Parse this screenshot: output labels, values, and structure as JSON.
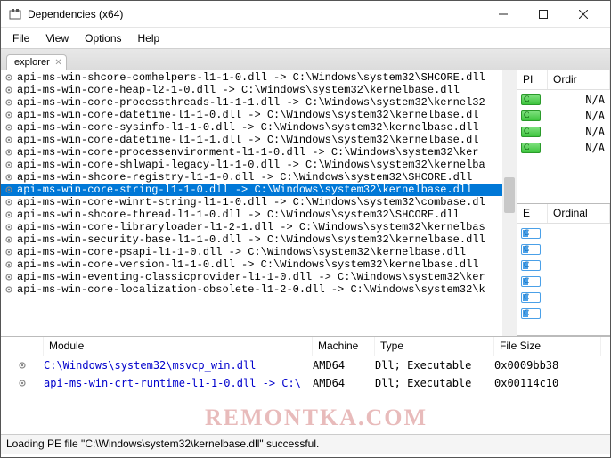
{
  "window": {
    "title": "Dependencies (x64)"
  },
  "menu": {
    "file": "File",
    "view": "View",
    "options": "Options",
    "help": "Help"
  },
  "tab": {
    "label": "explorer"
  },
  "filelist": [
    "api-ms-win-shcore-comhelpers-l1-1-0.dll -> C:\\Windows\\system32\\SHCORE.dll",
    "api-ms-win-core-heap-l2-1-0.dll -> C:\\Windows\\system32\\kernelbase.dll",
    "api-ms-win-core-processthreads-l1-1-1.dll -> C:\\Windows\\system32\\kernel32",
    "api-ms-win-core-datetime-l1-1-0.dll -> C:\\Windows\\system32\\kernelbase.dl",
    "api-ms-win-core-sysinfo-l1-1-0.dll -> C:\\Windows\\system32\\kernelbase.dll",
    "api-ms-win-core-datetime-l1-1-1.dll -> C:\\Windows\\system32\\kernelbase.dl",
    "api-ms-win-core-processenvironment-l1-1-0.dll -> C:\\Windows\\system32\\ker",
    "api-ms-win-core-shlwapi-legacy-l1-1-0.dll -> C:\\Windows\\system32\\kernelba",
    "api-ms-win-shcore-registry-l1-1-0.dll -> C:\\Windows\\system32\\SHCORE.dll",
    "api-ms-win-core-string-l1-1-0.dll -> C:\\Windows\\system32\\kernelbase.dll",
    "api-ms-win-core-winrt-string-l1-1-0.dll -> C:\\Windows\\system32\\combase.dl",
    "api-ms-win-shcore-thread-l1-1-0.dll -> C:\\Windows\\system32\\SHCORE.dll",
    "api-ms-win-core-libraryloader-l1-2-1.dll -> C:\\Windows\\system32\\kernelbas",
    "api-ms-win-security-base-l1-1-0.dll -> C:\\Windows\\system32\\kernelbase.dll",
    "api-ms-win-core-psapi-l1-1-0.dll -> C:\\Windows\\system32\\kernelbase.dll",
    "api-ms-win-core-version-l1-1-0.dll -> C:\\Windows\\system32\\kernelbase.dll",
    "api-ms-win-eventing-classicprovider-l1-1-0.dll -> C:\\Windows\\system32\\ker",
    "api-ms-win-core-localization-obsolete-l1-2-0.dll -> C:\\Windows\\system32\\k"
  ],
  "selected_index": 9,
  "right1": {
    "cols": [
      "PI",
      "Ordir"
    ],
    "rows": [
      {
        "val": "N/A"
      },
      {
        "val": "N/A"
      },
      {
        "val": "N/A"
      },
      {
        "val": "N/A"
      }
    ]
  },
  "right2": {
    "cols": [
      "E",
      "Ordinal"
    ],
    "rows": [
      {},
      {},
      {},
      {},
      {},
      {}
    ]
  },
  "bottom": {
    "cols": [
      "",
      "Module",
      "Machine",
      "Type",
      "File Size"
    ],
    "rows": [
      {
        "module": "C:\\Windows\\system32\\msvcp_win.dll",
        "machine": "AMD64",
        "type": "Dll; Executable",
        "size": "0x0009bb38"
      },
      {
        "module": "api-ms-win-crt-runtime-l1-1-0.dll -> C:\\",
        "machine": "AMD64",
        "type": "Dll; Executable",
        "size": "0x00114c10"
      }
    ]
  },
  "status": "Loading PE file \"C:\\Windows\\system32\\kernelbase.dll\" successful.",
  "watermark": "REMONTKA.COM"
}
